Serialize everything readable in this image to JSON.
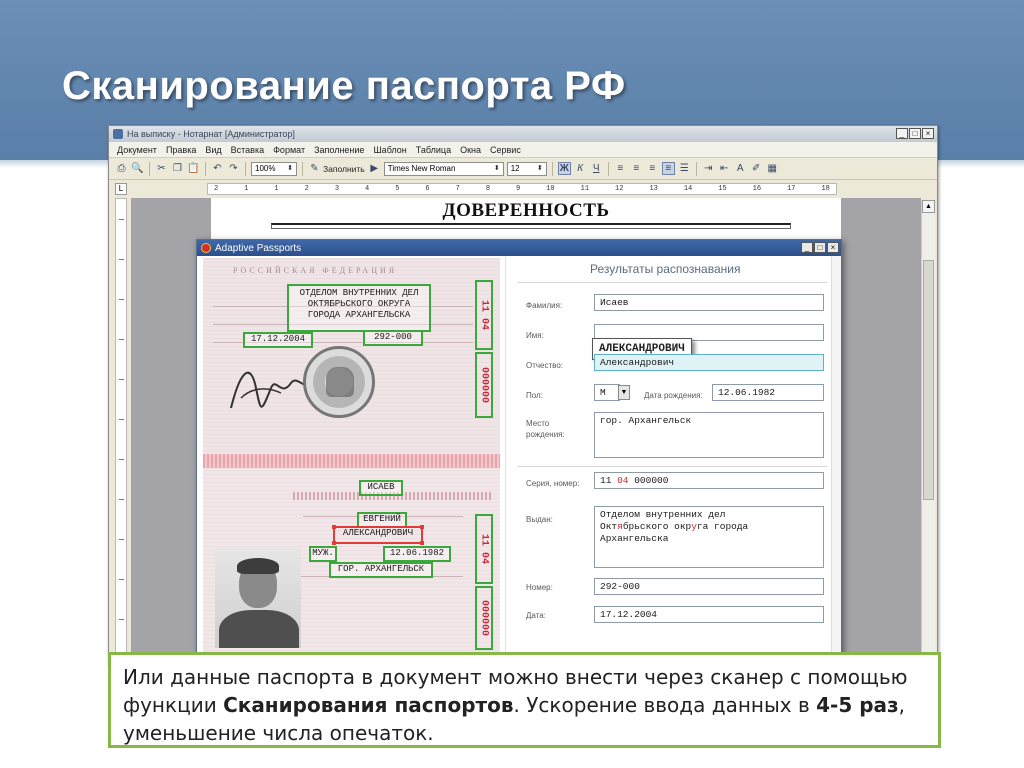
{
  "slide": {
    "title": "Сканирование паспорта РФ"
  },
  "word": {
    "window_title": "На выписку - Нотарнат [Администратор]",
    "controls": [
      "_",
      "□",
      "×"
    ],
    "menu": [
      "Документ",
      "Правка",
      "Вид",
      "Вставка",
      "Формат",
      "Заполнение",
      "Шаблон",
      "Таблица",
      "Окна",
      "Сервис"
    ],
    "zoom": "100%",
    "fill_button": "Заполнить",
    "font_name": "Times New Roman",
    "font_size": "12",
    "format_buttons": [
      "Ж",
      "К",
      "Ч"
    ],
    "ruler_ticks": [
      "2",
      "1",
      "1",
      "2",
      "3",
      "4",
      "5",
      "6",
      "7",
      "8",
      "9",
      "10",
      "11",
      "12",
      "13",
      "14",
      "15",
      "16",
      "17",
      "18"
    ],
    "document_title": "ДОВЕРЕННОСТЬ"
  },
  "dialog": {
    "title": "Adaptive Passports",
    "passport": {
      "header": "РОССИЙСКАЯ ФЕДЕРАЦИЯ",
      "issuer_lines": [
        "ОТДЕЛОМ ВНУТРЕННИХ ДЕЛ",
        "ОКТЯБРЬСКОГО ОКРУГА",
        "ГОРОДА АРХАНГЕЛЬСКА"
      ],
      "issue_date": "17.12.2004",
      "division_code": "292-000",
      "series_top": "11  04",
      "number_top": "000000",
      "surname": "ИСАЕВ",
      "first_name": "ЕВГЕНИЙ",
      "patronymic": "АЛЕКСАНДРОВИЧ",
      "sex": "МУЖ.",
      "birth_date": "12.06.1982",
      "birth_place": "ГОР. АРХАНГЕЛЬСК",
      "series_bottom": "11  04",
      "number_bottom": "000000"
    },
    "results": {
      "heading": "Результаты распознавания",
      "surname_label": "Фамилия:",
      "surname": "Исаев",
      "name_label": "Имя:",
      "tooltip": "АЛЕКСАНДРОВИЧ",
      "patronymic_label": "Отчество:",
      "patronymic": "Александрович",
      "sex_label": "Пол:",
      "sex": "М",
      "birth_date_label": "Дата рождения:",
      "birth_date": "12.06.1982",
      "birth_place_label": "Место рождения:",
      "birth_place": "гор. Архангельск",
      "series_label": "Серия, номер:",
      "series_a": "11 ",
      "series_b": "04",
      "series_c": " 000000",
      "issued_label": "Выдан:",
      "issued_line1": "Отделом внутренних дел",
      "issued_line2a": "Окт",
      "issued_line2b": "я",
      "issued_line2c": "брьского окр",
      "issued_line2d": "у",
      "issued_line2e": "га города",
      "issued_line3": "Архангельска",
      "number_label": "Номер:",
      "number": "292-000",
      "date_label": "Дата:",
      "date": "17.12.2004"
    }
  },
  "caption": {
    "part1": "Или данные паспорта в документ можно внести через сканер с помощью функции ",
    "bold1": "Сканирования паспортов",
    "part2": ". Ускорение ввода данных в ",
    "bold2": "4-5 раз",
    "part3": ", уменьшение числа опечаток."
  },
  "colors": {
    "header_blue": "#5f83ac",
    "caption_border": "#86b847",
    "ocr_green": "#3aa83a",
    "ocr_red": "#e33a3a"
  }
}
